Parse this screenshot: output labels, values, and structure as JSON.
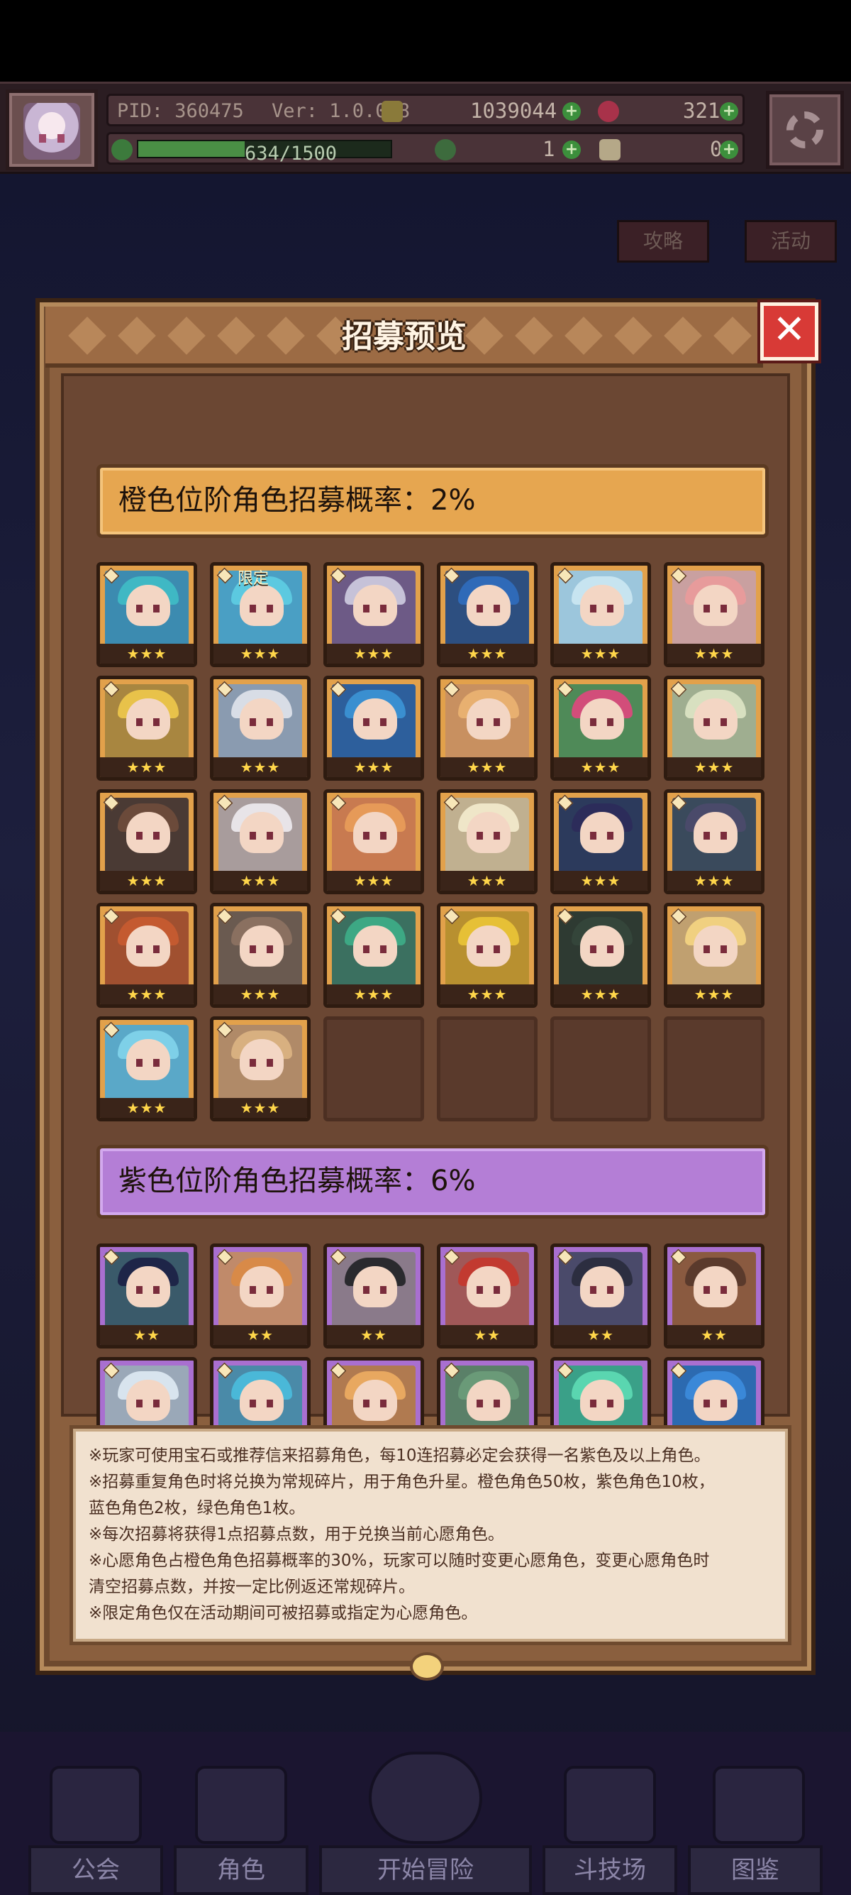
{
  "topbar": {
    "pid": "PID: 360475",
    "version": "Ver: 1.0.0.8",
    "gold": "1039044",
    "gems": "321",
    "exp": "634/1500",
    "exp_fraction": 0.4227,
    "clover": "1",
    "keys": "0"
  },
  "background": {
    "tabs": [
      "攻略",
      "活动"
    ],
    "bottom_nav": [
      "公会",
      "角色",
      "开始冒险",
      "斗技场",
      "图鉴"
    ]
  },
  "modal": {
    "title": "招募预览",
    "close": "✕",
    "orange_tier": {
      "label": "橙色位阶角色招募概率：2%",
      "limited_tag": "限定",
      "stars": "★★★",
      "count": 26
    },
    "purple_tier": {
      "label": "紫色位阶角色招募概率：6%",
      "stars": "★★",
      "count": 12
    },
    "notes": [
      "※玩家可使用宝石或推荐信来招募角色，每10连招募必定会获得一名紫色及以上角色。",
      "※招募重复角色时将兑换为常规碎片，用于角色升星。橙色角色50枚，紫色角色10枚，",
      "蓝色角色2枚，绿色角色1枚。",
      "※每次招募将获得1点招募点数，用于兑换当前心愿角色。",
      "※心愿角色占橙色角色招募概率的30%，玩家可以随时变更心愿角色，变更心愿角色时",
      "清空招募点数，并按一定比例返还常规碎片。",
      "※限定角色仅在活动期间可被招募或指定为心愿角色。"
    ]
  },
  "colors": {
    "orange_tier": "#e6a650",
    "purple_tier": "#b47ed6",
    "close_button": "#d83a36",
    "frame": "#8a5f3e"
  }
}
